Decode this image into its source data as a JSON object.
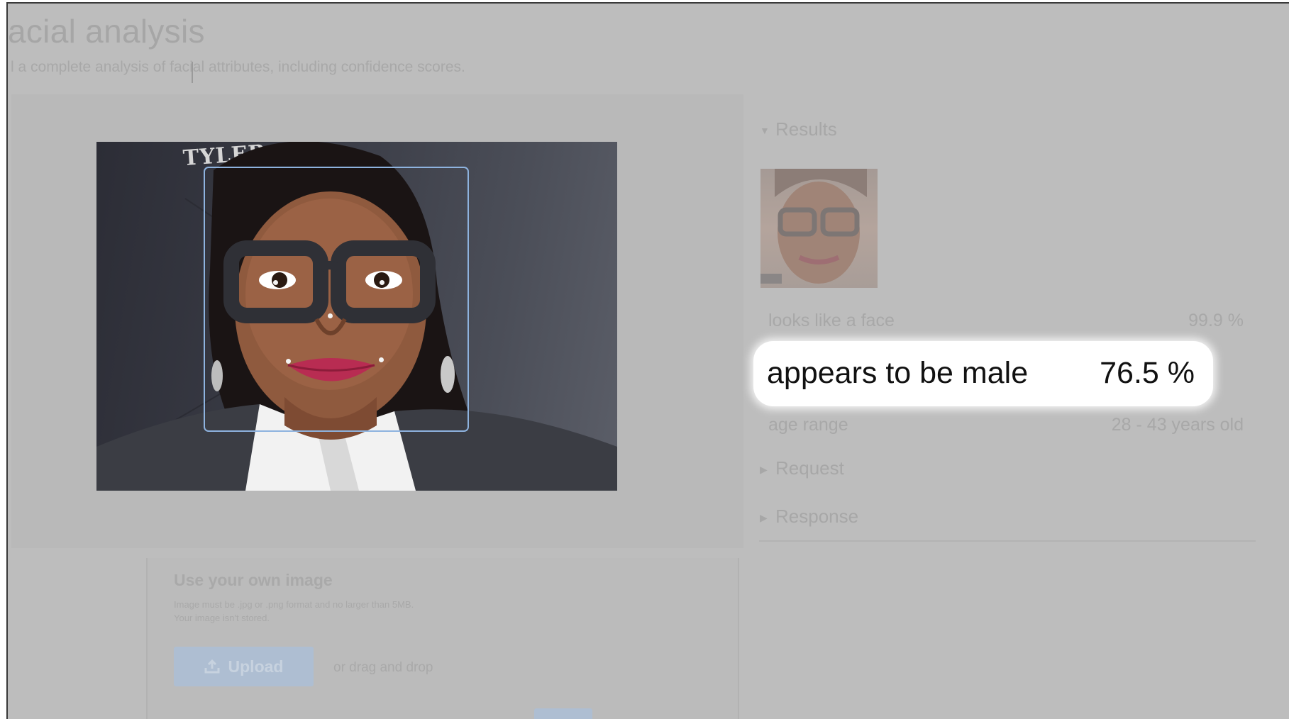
{
  "page": {
    "title": "acial analysis",
    "subtitle": "l a complete analysis of facial attributes, including confidence scores."
  },
  "demo": {
    "backdrop_text": "TYLER"
  },
  "results": {
    "section_label": "Results",
    "rows": [
      {
        "label": "looks like a face",
        "value": "99.9 %"
      },
      {
        "label": "appears to be male",
        "value": "76.5 %"
      },
      {
        "label": "age range",
        "value": "28 - 43 years old"
      }
    ],
    "request_label": "Request",
    "response_label": "Response"
  },
  "upload": {
    "title": "Use your own image",
    "hint": "Image must be .jpg or .png format and no larger than 5MB. Your image isn't stored.",
    "button_label": "Upload",
    "or_text": "or drag and drop"
  },
  "colors": {
    "overlay_gray": "#bdbdbd",
    "face_box": "#8eb3df",
    "highlight_bg": "#ffffff"
  }
}
